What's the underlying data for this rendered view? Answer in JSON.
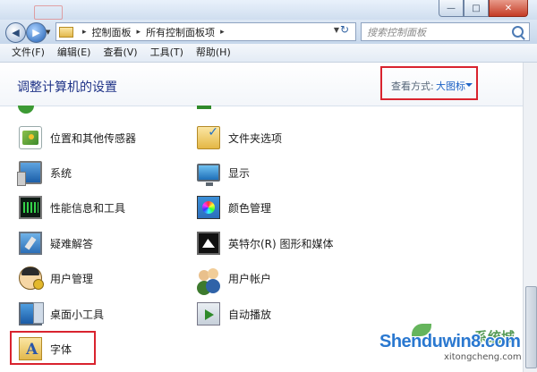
{
  "window": {
    "min_symbol": "—",
    "max_symbol": "□",
    "close_symbol": "✕"
  },
  "nav": {
    "back_symbol": "◀",
    "forward_symbol": "▶",
    "history_dropdown": "▼",
    "address_segments": [
      "控制面板",
      "所有控制面板项"
    ],
    "address_separator": "▸",
    "address_dropdown": "▼",
    "refresh_symbol": "↻",
    "search_placeholder": "搜索控制面板"
  },
  "menu": [
    "文件(F)",
    "编辑(E)",
    "查看(V)",
    "工具(T)",
    "帮助(H)"
  ],
  "header": {
    "title": "调整计算机的设置",
    "view_label": "查看方式:",
    "view_value": "大图标"
  },
  "items": {
    "left": [
      {
        "label": "位置和其他传感器",
        "icon": "location-sensor-icon"
      },
      {
        "label": "系统",
        "icon": "system-icon"
      },
      {
        "label": "性能信息和工具",
        "icon": "performance-icon"
      },
      {
        "label": "疑难解答",
        "icon": "troubleshooting-icon"
      },
      {
        "label": "用户管理",
        "icon": "user-management-icon"
      },
      {
        "label": "桌面小工具",
        "icon": "desktop-gadgets-icon"
      },
      {
        "label": "字体",
        "icon": "fonts-icon"
      }
    ],
    "right": [
      {
        "label": "文件夹选项",
        "icon": "folder-options-icon"
      },
      {
        "label": "显示",
        "icon": "display-icon"
      },
      {
        "label": "颜色管理",
        "icon": "color-management-icon"
      },
      {
        "label": "英特尔(R) 图形和媒体",
        "icon": "intel-graphics-icon"
      },
      {
        "label": "用户帐户",
        "icon": "user-accounts-icon"
      },
      {
        "label": "自动播放",
        "icon": "autoplay-icon"
      }
    ]
  },
  "watermark": {
    "brand": "Shenduwin8.com",
    "sub": "xitongcheng.com",
    "cn": "系统城"
  },
  "colors": {
    "highlight_box": "#d9232e",
    "link_blue": "#1f63c5",
    "title_blue": "#1e3287"
  }
}
